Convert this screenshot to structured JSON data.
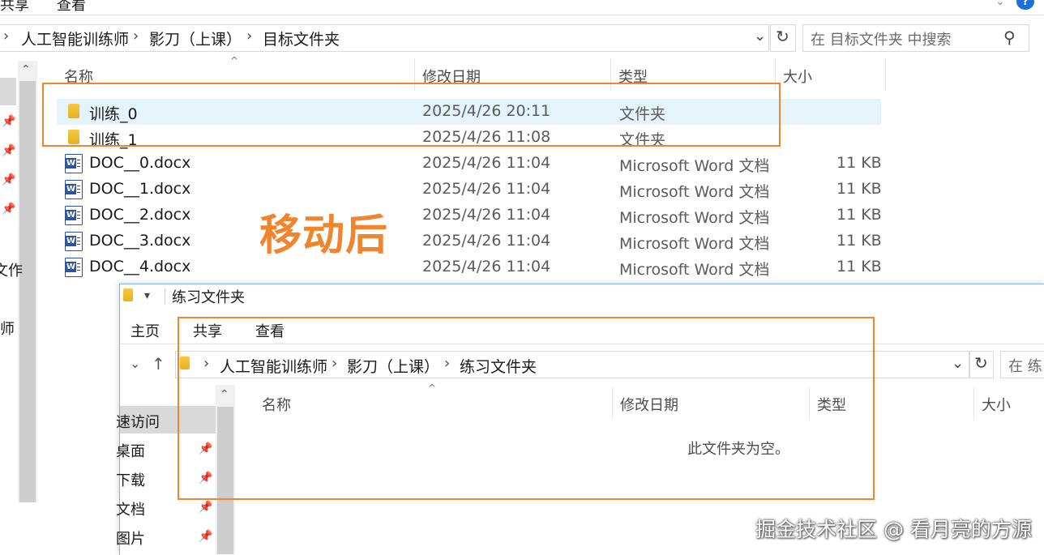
{
  "back_window": {
    "ribbon_tabs": [
      "共享",
      "查看"
    ],
    "breadcrumb": [
      "人工智能训练师",
      "影刀（上课）",
      "目标文件夹"
    ],
    "search_placeholder": "在 目标文件夹 中搜索",
    "columns": [
      "名称",
      "修改日期",
      "类型",
      "大小"
    ],
    "rows": [
      {
        "name": "训练_0",
        "date": "2025/4/26 20:11",
        "type": "文件夹",
        "size": "",
        "icon": "folder-icon",
        "selected": true
      },
      {
        "name": "训练_1",
        "date": "2025/4/26 11:08",
        "type": "文件夹",
        "size": "",
        "icon": "folder-icon"
      },
      {
        "name": "DOC__0.docx",
        "date": "2025/4/26 11:04",
        "type": "Microsoft Word 文档",
        "size": "11 KB",
        "icon": "word-doc-icon"
      },
      {
        "name": "DOC__1.docx",
        "date": "2025/4/26 11:04",
        "type": "Microsoft Word 文档",
        "size": "11 KB",
        "icon": "word-doc-icon"
      },
      {
        "name": "DOC__2.docx",
        "date": "2025/4/26 11:04",
        "type": "Microsoft Word 文档",
        "size": "11 KB",
        "icon": "word-doc-icon"
      },
      {
        "name": "DOC__3.docx",
        "date": "2025/4/26 11:04",
        "type": "Microsoft Word 文档",
        "size": "11 KB",
        "icon": "word-doc-icon"
      },
      {
        "name": "DOC__4.docx",
        "date": "2025/4/26 11:04",
        "type": "Microsoft Word 文档",
        "size": "11 KB",
        "icon": "word-doc-icon"
      }
    ],
    "nav_partial_labels": [
      "文作",
      "师"
    ]
  },
  "annotation_text": "移动后",
  "front_window": {
    "title": "练习文件夹",
    "ribbon_tabs": [
      "主页",
      "共享",
      "查看"
    ],
    "breadcrumb": [
      "人工智能训练师",
      "影刀（上课）",
      "练习文件夹"
    ],
    "search_placeholder": "在 练",
    "columns": [
      "名称",
      "修改日期",
      "类型",
      "大小"
    ],
    "empty_message": "此文件夹为空。",
    "nav_items": [
      "速访问",
      "桌面",
      "下载",
      "文档",
      "图片"
    ]
  },
  "watermark": "掘金技术社区 @ 看月亮的方源",
  "colors": {
    "annotation": "#f0852d",
    "selected_row": "#e5f3fb",
    "help_icon": "#1e6fd9"
  }
}
